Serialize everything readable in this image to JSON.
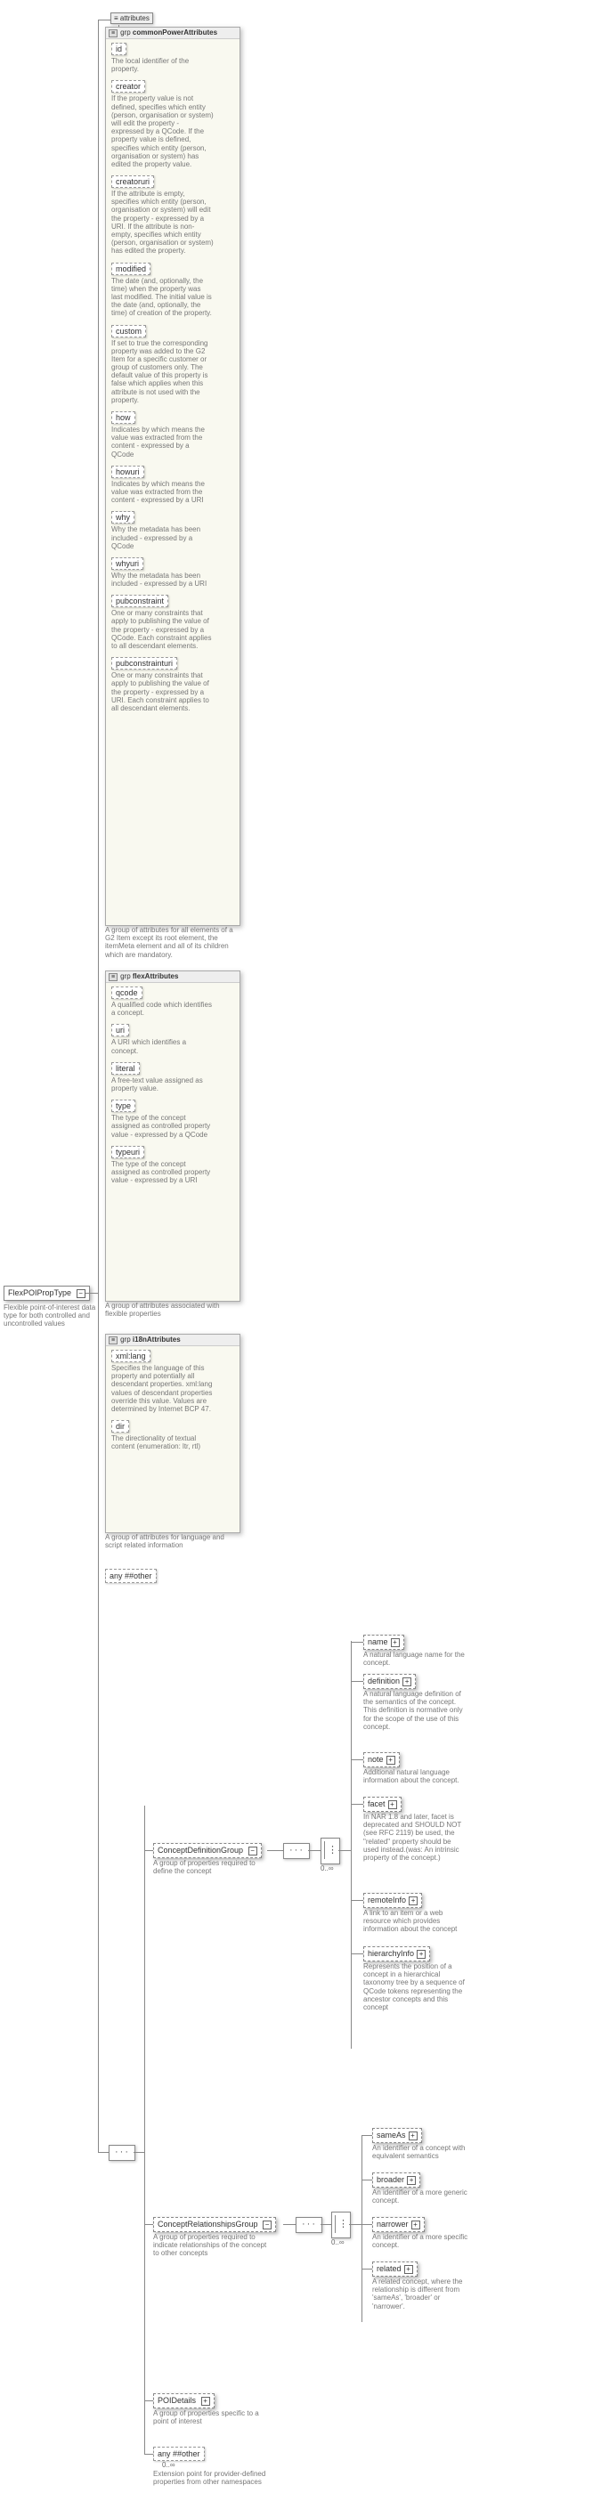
{
  "root": {
    "name": "FlexPOIPropType",
    "desc": "Flexible point-of-interest data type for both controlled and uncontrolled values"
  },
  "attributes_label": "attributes",
  "grp_label": "grp",
  "commonPowerAttributes": {
    "title": "commonPowerAttributes",
    "items": [
      {
        "name": "id",
        "desc": "The local identifier of the property."
      },
      {
        "name": "creator",
        "desc": "If the property value is not defined, specifies which entity (person, organisation or system) will edit the property - expressed by a QCode. If the property value is defined, specifies which entity (person, organisation or system) has edited the property value."
      },
      {
        "name": "creatoruri",
        "desc": "If the attribute is empty, specifies which entity (person, organisation or system) will edit the property - expressed by a URI. If the attribute is non-empty, specifies which entity (person, organisation or system) has edited the property."
      },
      {
        "name": "modified",
        "desc": "The date (and, optionally, the time) when the property was last modified. The initial value is the date (and, optionally, the time) of creation of the property."
      },
      {
        "name": "custom",
        "desc": "If set to true the corresponding property was added to the G2 Item for a specific customer or group of customers only. The default value of this property is false which applies when this attribute is not used with the property."
      },
      {
        "name": "how",
        "desc": "Indicates by which means the value was extracted from the content - expressed by a QCode"
      },
      {
        "name": "howuri",
        "desc": "Indicates by which means the value was extracted from the content - expressed by a URI"
      },
      {
        "name": "why",
        "desc": "Why the metadata has been included - expressed by a QCode"
      },
      {
        "name": "whyuri",
        "desc": "Why the metadata has been included - expressed by a URI"
      },
      {
        "name": "pubconstraint",
        "desc": "One or many constraints that apply to publishing the value of the property - expressed by a QCode. Each constraint applies to all descendant elements."
      },
      {
        "name": "pubconstrainturi",
        "desc": "One or many constraints that apply to publishing the value of the property - expressed by a URI. Each constraint applies to all descendant elements."
      }
    ],
    "caption": "A group of attributes for all elements of a G2 Item except its root element, the itemMeta element and all of its children which are mandatory."
  },
  "flexAttributes": {
    "title": "flexAttributes",
    "items": [
      {
        "name": "qcode",
        "desc": "A qualified code which identifies a concept."
      },
      {
        "name": "uri",
        "desc": "A URI which identifies a concept."
      },
      {
        "name": "literal",
        "desc": "A free-text value assigned as property value."
      },
      {
        "name": "type",
        "desc": "The type of the concept assigned as controlled property value - expressed by a QCode"
      },
      {
        "name": "typeuri",
        "desc": "The type of the concept assigned as controlled property value - expressed by a URI"
      }
    ],
    "caption": "A group of attributes associated with flexible properties"
  },
  "i18nAttributes": {
    "title": "i18nAttributes",
    "items": [
      {
        "name": "xml:lang",
        "desc": "Specifies the language of this property and potentially all descendant properties. xml:lang values of descendant properties override this value. Values are determined by Internet BCP 47."
      },
      {
        "name": "dir",
        "desc": "The directionality of textual content (enumeration: ltr, rtl)"
      }
    ],
    "caption": "A group of attributes for language and script related information"
  },
  "any_other": "any ##other",
  "conceptDefinition": {
    "title": "ConceptDefinitionGroup",
    "desc": "A group of properties required to define the concept",
    "occ": "0..∞",
    "children": [
      {
        "name": "name",
        "desc": "A natural language name for the concept."
      },
      {
        "name": "definition",
        "desc": "A natural language definition of the semantics of the concept. This definition is normative only for the scope of the use of this concept."
      },
      {
        "name": "note",
        "desc": "Additional natural language information about the concept."
      },
      {
        "name": "facet",
        "desc": "In NAR 1.8 and later, facet is deprecated and SHOULD NOT (see RFC 2119) be used, the \"related\" property should be used instead.(was: An intrinsic property of the concept.)"
      },
      {
        "name": "remoteInfo",
        "desc": "A link to an item or a web resource which provides information about the concept"
      },
      {
        "name": "hierarchyInfo",
        "desc": "Represents the position of a concept in a hierarchical taxonomy tree by a sequence of QCode tokens representing the ancestor concepts and this concept"
      }
    ]
  },
  "conceptRelationships": {
    "title": "ConceptRelationshipsGroup",
    "desc": "A group of properties required to indicate relationships of the concept to other concepts",
    "occ": "0..∞",
    "children": [
      {
        "name": "sameAs",
        "desc": "An identifier of a concept with equivalent semantics"
      },
      {
        "name": "broader",
        "desc": "An identifier of a more generic concept."
      },
      {
        "name": "narrower",
        "desc": "An identifier of a more specific concept."
      },
      {
        "name": "related",
        "desc": "A related concept, where the relationship is different from 'sameAs', 'broader' or 'narrower'."
      }
    ]
  },
  "poiDetails": {
    "name": "POIDetails",
    "desc": "A group of properties specific to a point of interest"
  },
  "bottom_any": {
    "name": "any ##other",
    "occ": "0..∞",
    "desc": "Extension point for provider-defined properties from other namespaces"
  }
}
